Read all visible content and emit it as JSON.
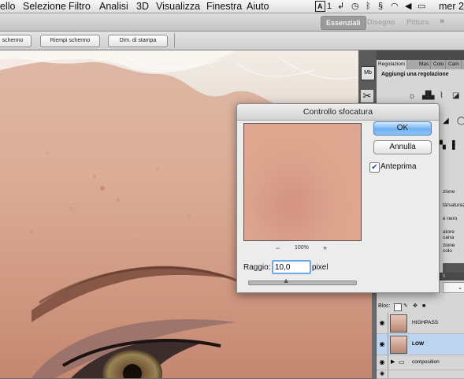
{
  "menubar": {
    "items": [
      "ello",
      "Selezione",
      "Filtro",
      "Analisi",
      "3D",
      "Visualizza",
      "Finestra",
      "Aiuto"
    ],
    "tray_text": "1",
    "clock": "mer 2"
  },
  "appbar": {
    "workspaces": [
      "Essenziali",
      "Disegno",
      "Pittura"
    ],
    "more": "»"
  },
  "options": {
    "btn_schermo": "schermo",
    "btn_riempi": "Riempi schermo",
    "btn_dim": "Dim. di stampa"
  },
  "panel": {
    "tabs": [
      "Regolazioni",
      "Mas",
      "Colo",
      "Cam"
    ],
    "subtitle": "Aggiungi una regolazione",
    "list_items": [
      "zione",
      "tà/saturaz",
      "e nero",
      "atore cana",
      "zione colo"
    ],
    "layers_label": "Bloc:",
    "layers": [
      {
        "name": "HIGHPASS"
      },
      {
        "name": "LOW"
      },
      {
        "name": "composition"
      }
    ]
  },
  "dialog": {
    "title": "Controllo sfocatura",
    "ok": "OK",
    "cancel": "Annulla",
    "preview_label": "Anteprima",
    "preview_checked": true,
    "zoom_minus": "−",
    "zoom_value": "100%",
    "zoom_plus": "+",
    "radius_label": "Raggio:",
    "radius_value": "10,0",
    "radius_unit": "pixel",
    "slider_level": 0.35
  },
  "colors": {
    "ok_blue": "#6fb1f2",
    "selected_layer": "#bcd4f0"
  }
}
